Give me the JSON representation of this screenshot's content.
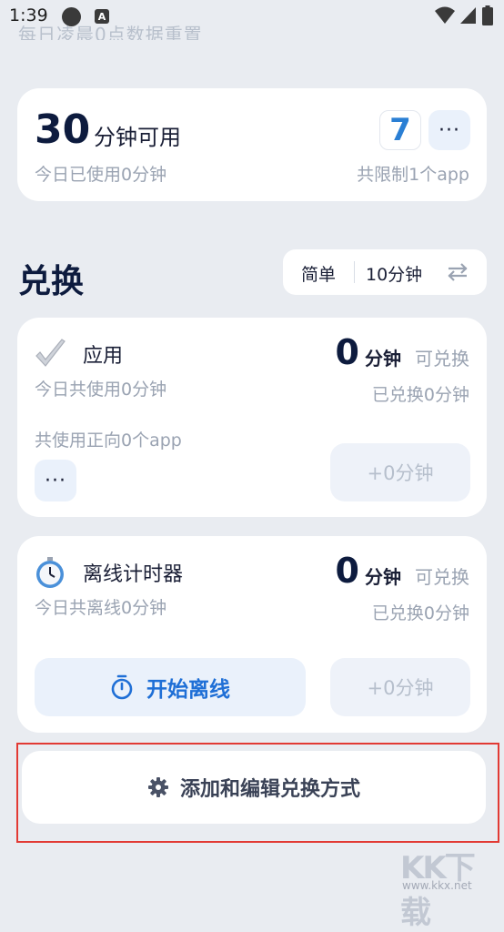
{
  "status_bar": {
    "time": "1:39",
    "notification_icon_letter": "A"
  },
  "faded_header": "每日凌晨0点数据重置",
  "summary": {
    "minutes_value": "30",
    "minutes_unit": "分钟可用",
    "today_used": "今日已使用0分钟",
    "calendar_badge": "7",
    "more_label": "···",
    "limit_text": "共限制1个app"
  },
  "exchange": {
    "title": "兑换",
    "mode_simple": "简单",
    "mode_minutes": "10分钟"
  },
  "app_card": {
    "icon": "check-mark-icon",
    "title": "应用",
    "today_usage": "今日共使用0分钟",
    "zero": "0",
    "unit": "分钟",
    "available": "可兑换",
    "redeemed": "已兑换0分钟",
    "apps_text": "共使用正向0个app",
    "more_label": "···",
    "plus_label": "+0分钟"
  },
  "offline_card": {
    "icon": "stopwatch-icon",
    "title": "离线计时器",
    "today_offline": "今日共离线0分钟",
    "zero": "0",
    "unit": "分钟",
    "available": "可兑换",
    "redeemed": "已兑换0分钟",
    "start_label": "开始离线",
    "plus_label": "+0分钟"
  },
  "add_edit": {
    "label": "添加和编辑兑换方式"
  },
  "watermark": {
    "text": "KK下载",
    "url": "www.kkx.net"
  },
  "colors": {
    "accent_blue": "#1f6fd6",
    "highlight_red": "#e23a34",
    "background": "#e9ecf1"
  }
}
